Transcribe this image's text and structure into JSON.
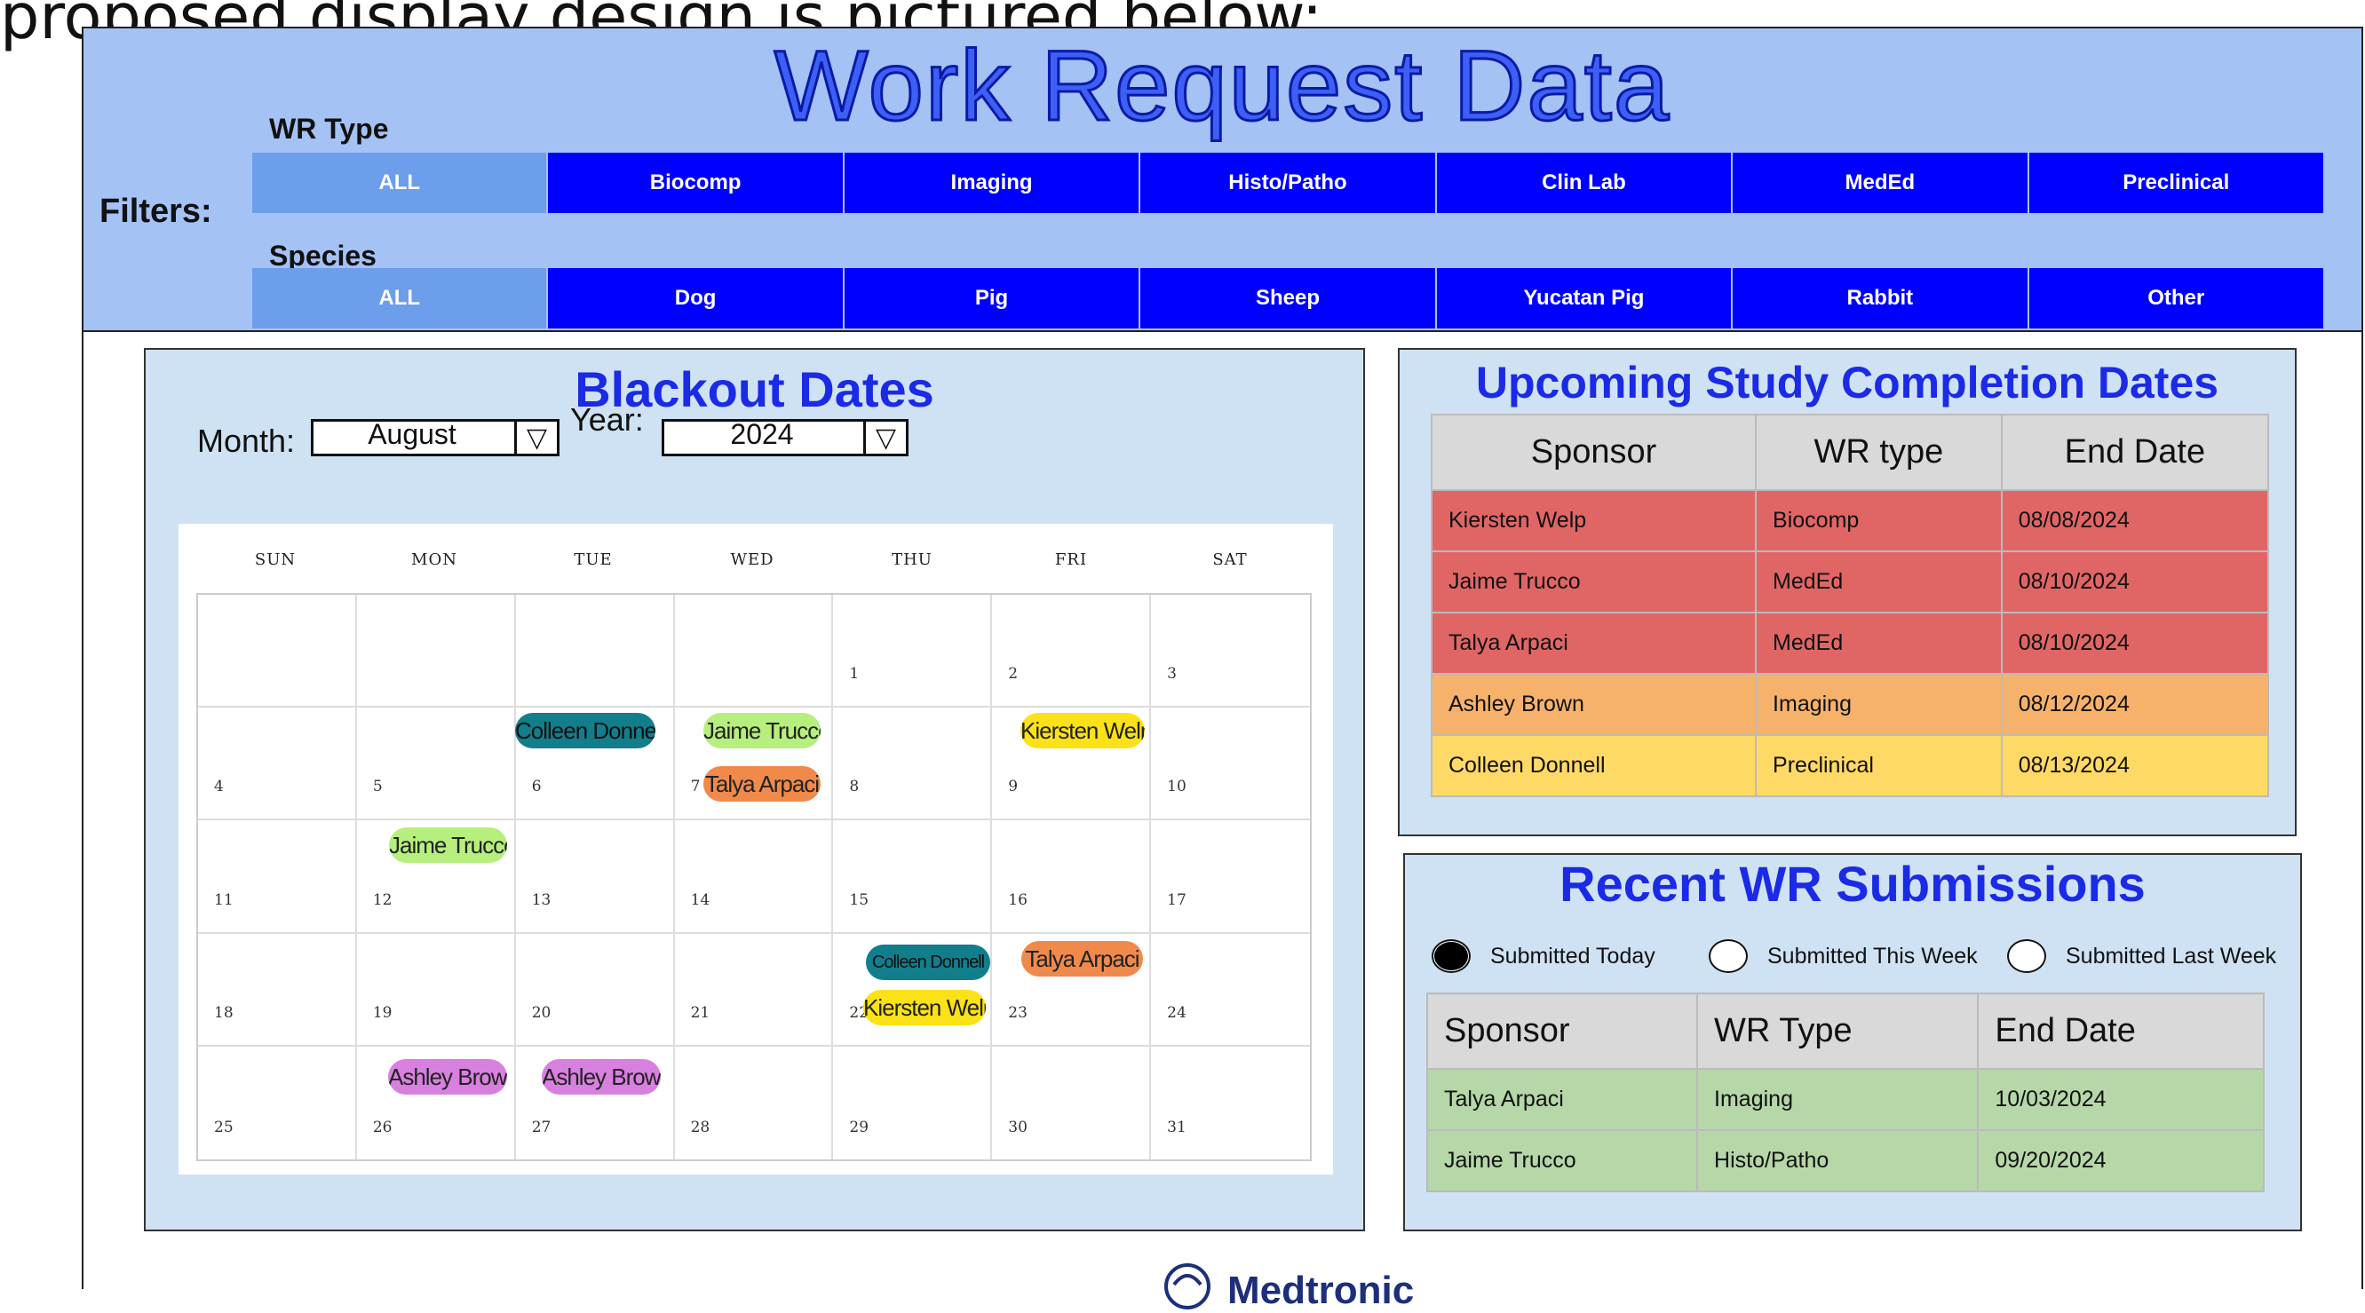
{
  "caption": "proposed display design is pictured below:",
  "header": {
    "title": "Work Request Data",
    "filters_label": "Filters:",
    "wr_type_label": "WR Type",
    "species_label": "Species",
    "wr_types": [
      "ALL",
      "Biocomp",
      "Imaging",
      "Histo/Patho",
      "Clin Lab",
      "MedEd",
      "Preclinical"
    ],
    "species": [
      "ALL",
      "Dog",
      "Pig",
      "Sheep",
      "Yucatan Pig",
      "Rabbit",
      "Other"
    ]
  },
  "blackout": {
    "title": "Blackout Dates",
    "month_label": "Month:",
    "month_value": "August",
    "year_label": "Year:",
    "year_value": "2024",
    "weekdays": [
      "SUN",
      "MON",
      "TUE",
      "WED",
      "THU",
      "FRI",
      "SAT"
    ],
    "weeks": [
      [
        "",
        "",
        "",
        "",
        "1",
        "2",
        "3"
      ],
      [
        "4",
        "5",
        "6",
        "7",
        "8",
        "9",
        "10"
      ],
      [
        "11",
        "12",
        "13",
        "14",
        "15",
        "16",
        "17"
      ],
      [
        "18",
        "19",
        "20",
        "21",
        "22",
        "23",
        "24"
      ],
      [
        "25",
        "26",
        "27",
        "28",
        "29",
        "30",
        "31"
      ]
    ],
    "events": {
      "colleen_6": "Colleen Donnell",
      "jaime_7": "Jaime Trucco",
      "talya_7": "Talya Arpaci",
      "kiersten_9": "Kiersten Welp",
      "jaime_12": "Jaime Trucco",
      "colleen_22": "Colleen Donnell",
      "kiersten_22": "Kiersten Welp",
      "talya_23": "Talya Arpaci",
      "ashley_26": "Ashley Brown",
      "ashley_27": "Ashley Brown"
    },
    "event_colors": {
      "teal": "#127e8c",
      "green": "#b6ef7d",
      "yellow": "#fbe216",
      "orange": "#f08a4b",
      "purple": "#d880e0"
    }
  },
  "upcoming": {
    "title": "Upcoming Study Completion Dates",
    "headers": [
      "Sponsor",
      "WR type",
      "End Date"
    ],
    "rows": [
      [
        "Kiersten Welp",
        "Biocomp",
        "08/08/2024"
      ],
      [
        "Jaime Trucco",
        "MedEd",
        "08/10/2024"
      ],
      [
        "Talya Arpaci",
        "MedEd",
        "08/10/2024"
      ],
      [
        "Ashley Brown",
        "Imaging",
        "08/12/2024"
      ],
      [
        "Colleen Donnell",
        "Preclinical",
        "08/13/2024"
      ]
    ],
    "row_colors": [
      "#e06666",
      "#e06666",
      "#e06666",
      "#f6b26b",
      "#ffd966"
    ]
  },
  "recent": {
    "title": "Recent WR Submissions",
    "options": [
      "Submitted Today",
      "Submitted This Week",
      "Submitted Last Week"
    ],
    "selected": "Submitted Today",
    "headers": [
      "Sponsor",
      "WR Type",
      "End Date"
    ],
    "rows": [
      [
        "Talya Arpaci",
        "Imaging",
        "10/03/2024"
      ],
      [
        "Jaime Trucco",
        "Histo/Patho",
        "09/20/2024"
      ]
    ],
    "row_color": "#b6d7a8"
  },
  "logo": {
    "text": "Medtronic",
    "icon": "medtronic-logo-icon"
  }
}
